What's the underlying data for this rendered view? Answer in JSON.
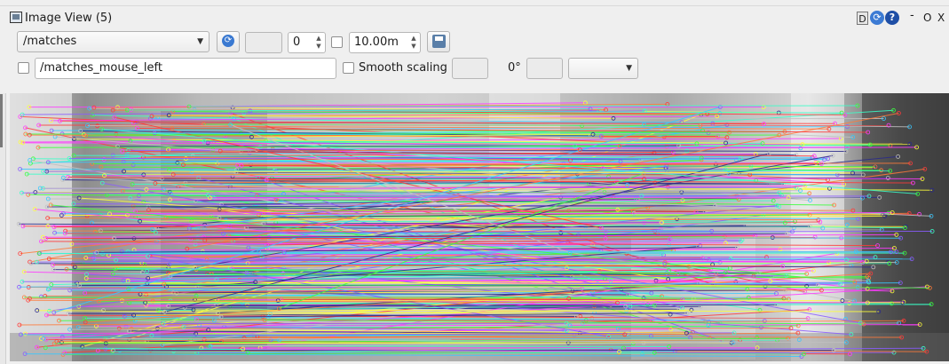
{
  "window": {
    "title": "Image View (5)"
  },
  "titlebar_buttons": {
    "d": "D",
    "minimize": "-",
    "float": "O",
    "close": "X"
  },
  "toolbar1": {
    "topic": "/matches",
    "blank1": "",
    "spin_value": "0",
    "timeout": "10.00m"
  },
  "toolbar2": {
    "mouse_topic": "/matches_mouse_left",
    "smooth_label": "Smooth scaling",
    "blank2": "",
    "rotation": "0°",
    "blank3": "",
    "blank4": ""
  },
  "icons": [
    "window-icon",
    "refresh-icon",
    "help-icon",
    "save-icon",
    "chevron-down-icon"
  ],
  "image": {
    "content": "feature matches visualization",
    "line_colors": [
      "#ff3bff",
      "#3bff3b",
      "#38c8ff",
      "#ffff3a",
      "#ff7a3a",
      "#8a5cff",
      "#2a2a8a",
      "#ff3a3a",
      "#3affc8",
      "#c0c0c0"
    ]
  }
}
